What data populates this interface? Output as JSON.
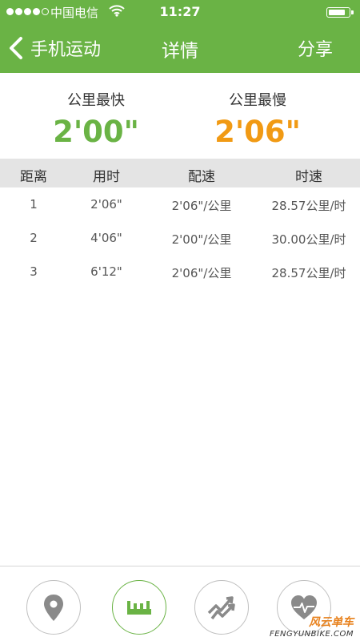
{
  "status_bar": {
    "carrier": "中国电信",
    "time": "11:27"
  },
  "nav": {
    "back_label": "手机运动",
    "title": "详情",
    "share_label": "分享"
  },
  "summary": {
    "fastest": {
      "label": "公里最快",
      "value": "2'00\"",
      "color": "#6ab345"
    },
    "slowest": {
      "label": "公里最慢",
      "value": "2'06\"",
      "color": "#f19a14"
    }
  },
  "table": {
    "headers": [
      "距离",
      "用时",
      "配速",
      "时速"
    ],
    "rows": [
      [
        "1",
        "2'06\"",
        "2'06\"/公里",
        "28.57公里/时"
      ],
      [
        "2",
        "4'06\"",
        "2'00\"/公里",
        "30.00公里/时"
      ],
      [
        "3",
        "6'12\"",
        "2'06\"/公里",
        "28.57公里/时"
      ]
    ]
  },
  "bottom_nav": [
    {
      "icon": "location-pin-icon",
      "active": false
    },
    {
      "icon": "ruler-icon",
      "active": true
    },
    {
      "icon": "trend-chart-icon",
      "active": false
    },
    {
      "icon": "heart-rate-icon",
      "active": false
    }
  ],
  "watermark": {
    "cn": "风云单车",
    "en": "FENGYUNBIKE.COM"
  },
  "colors": {
    "header": "#6ab345",
    "accent_green": "#6ab345",
    "accent_orange": "#f19a14",
    "table_header_bg": "#e4e4e4",
    "icon_gray": "#8a8a8a"
  }
}
